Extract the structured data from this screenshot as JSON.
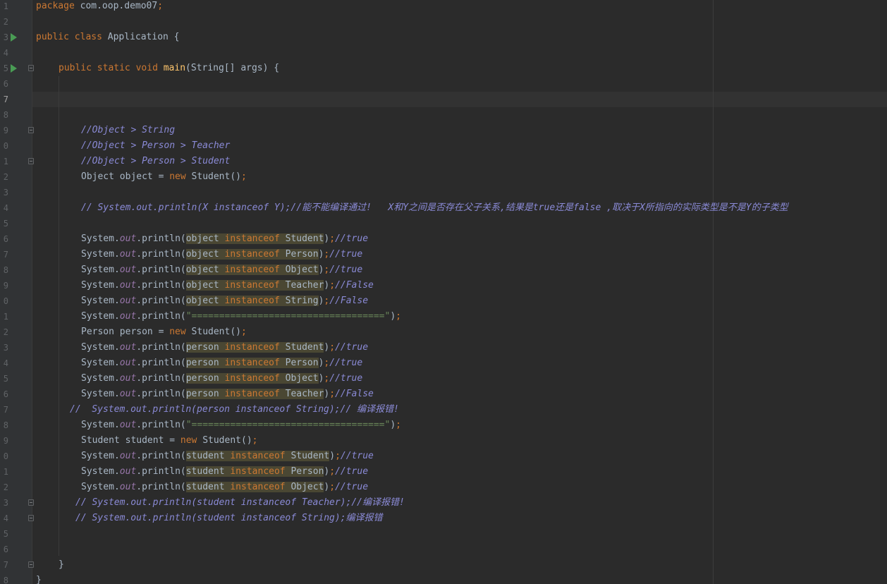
{
  "editor": {
    "language": "java",
    "package_line": {
      "kw": "package",
      "name": "com.oop.demo07",
      "semi": ";"
    },
    "lines": [
      {
        "n": "1"
      },
      {
        "n": "2"
      },
      {
        "n": "3"
      },
      {
        "n": "4"
      },
      {
        "n": "5"
      },
      {
        "n": "6"
      },
      {
        "n": "7"
      },
      {
        "n": "8"
      },
      {
        "n": "9"
      },
      {
        "n": "0"
      },
      {
        "n": "1"
      },
      {
        "n": "2"
      },
      {
        "n": "3"
      },
      {
        "n": "4"
      },
      {
        "n": "5"
      },
      {
        "n": "6"
      },
      {
        "n": "7"
      },
      {
        "n": "8"
      },
      {
        "n": "9"
      },
      {
        "n": "0"
      },
      {
        "n": "1"
      },
      {
        "n": "2"
      },
      {
        "n": "3"
      },
      {
        "n": "4"
      },
      {
        "n": "5"
      },
      {
        "n": "6"
      },
      {
        "n": "7"
      },
      {
        "n": "8"
      },
      {
        "n": "9"
      },
      {
        "n": "0"
      },
      {
        "n": "1"
      },
      {
        "n": "2"
      },
      {
        "n": "3"
      },
      {
        "n": "4"
      },
      {
        "n": "5"
      },
      {
        "n": "6"
      },
      {
        "n": "7"
      },
      {
        "n": "8"
      }
    ],
    "tokens": {
      "public": "public",
      "class": "class",
      "static": "static",
      "void": "void",
      "new": "new",
      "instanceof": "instanceof",
      "class_name": "Application",
      "main": "main",
      "main_params": "(String[] args) {",
      "open_brace": " {",
      "close_brace": "}",
      "system": "System.",
      "out": "out",
      "println": ".println(",
      "close_stmt": ");",
      "close_paren": ")",
      "semi": ";",
      "object_decl": "Object object = ",
      "person_decl": "Person person = ",
      "student_decl": "Student student = ",
      "student_ctor": "Student()",
      "sep_string": "\"===================================\""
    },
    "comments": {
      "c9": "//Object > String",
      "c10": "//Object > Person > Teacher",
      "c11": "//Object > Person > Student",
      "c14": "// System.out.println(X instanceof Y);//能不能编译通过!   X和Y之间是否存在父子关系,结果是true还是false ,取决于X所指向的实际类型是不是Y的子类型",
      "c27": "//  System.out.println(person instanceof String);// 编译报错!",
      "c33": "// System.out.println(student instanceof Teacher);//编译报错!",
      "c34": "// System.out.println(student instanceof String);编译报错"
    },
    "checks": [
      {
        "var": "object",
        "type": "Student",
        "comment": "//true"
      },
      {
        "var": "object",
        "type": "Person",
        "comment": "//true"
      },
      {
        "var": "object",
        "type": "Object",
        "comment": "//true"
      },
      {
        "var": "object",
        "type": "Teacher",
        "comment": "//False"
      },
      {
        "var": "object",
        "type": "String",
        "comment": "//False"
      },
      {
        "var": "person",
        "type": "Student",
        "comment": "//true"
      },
      {
        "var": "person",
        "type": "Person",
        "comment": "//true"
      },
      {
        "var": "person",
        "type": "Object",
        "comment": "//true"
      },
      {
        "var": "person",
        "type": "Teacher",
        "comment": "//False"
      },
      {
        "var": "student",
        "type": "Student",
        "comment": "//true"
      },
      {
        "var": "student",
        "type": "Person",
        "comment": "//true"
      },
      {
        "var": "student",
        "type": "Object",
        "comment": "//true"
      }
    ]
  }
}
